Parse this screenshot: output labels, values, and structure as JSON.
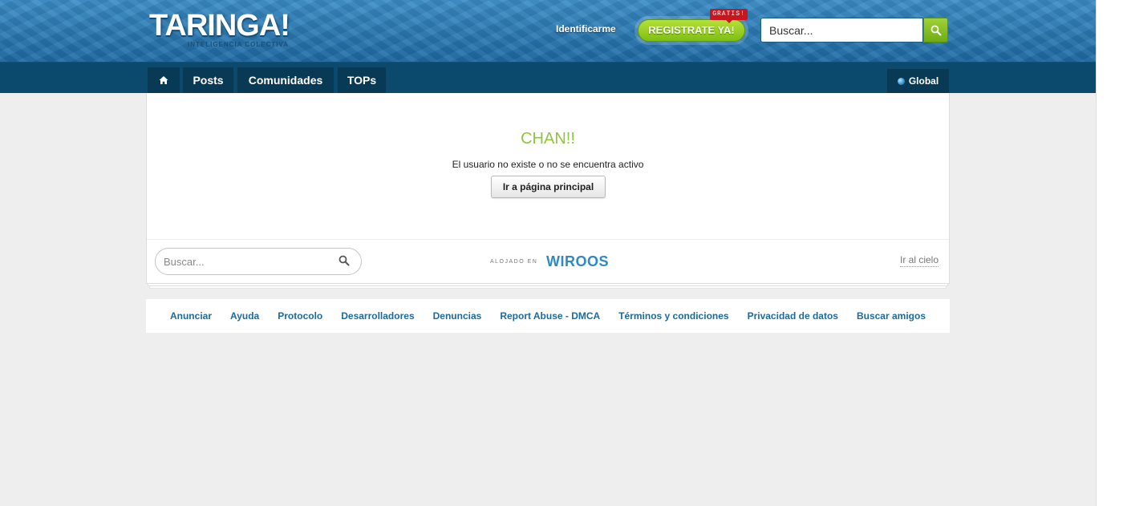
{
  "header": {
    "logo": "TARINGA!",
    "tagline": "INTELIGENCIA COLECTIVA",
    "login_label": "Identificarme",
    "register_label": "REGISTRATE YA!",
    "register_badge": "GRATIS!",
    "search_placeholder": "Buscar..."
  },
  "nav": {
    "items": [
      {
        "label": "Posts"
      },
      {
        "label": "Comunidades"
      },
      {
        "label": "TOPs"
      }
    ],
    "region_label": "Global"
  },
  "error": {
    "title": "CHAN!!",
    "message": "El usuario no existe o no se encuentra activo",
    "home_button": "Ir a página principal"
  },
  "panel_footer": {
    "search_placeholder": "Buscar...",
    "hosted_label": "ALOJADO EN",
    "hosted_brand": "WIROOS",
    "to_top_label": "Ir al cielo"
  },
  "footer_links": [
    {
      "label": "Anunciar"
    },
    {
      "label": "Ayuda"
    },
    {
      "label": "Protocolo"
    },
    {
      "label": "Desarrolladores"
    },
    {
      "label": "Denuncias"
    },
    {
      "label": "Report Abuse - DMCA"
    },
    {
      "label": "Términos y condiciones"
    },
    {
      "label": "Privacidad de datos"
    },
    {
      "label": "Buscar amigos"
    }
  ],
  "colors": {
    "header_blue": "#2c7bb3",
    "nav_dark": "#0b4a6c",
    "accent_green": "#8ec63f",
    "link_blue": "#1c6a9c"
  }
}
